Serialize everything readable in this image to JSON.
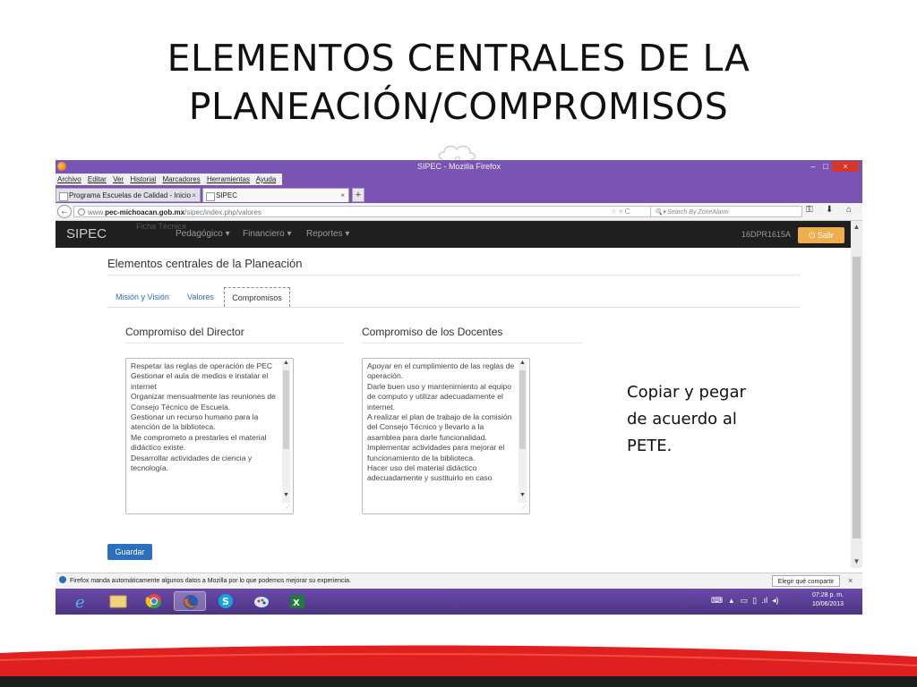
{
  "slide": {
    "title_line1": "ELEMENTOS CENTRALES DE LA",
    "title_line2": "PLANEACIÓN/COMPROMISOS",
    "side_note": "Copiar y pegar\nde acuerdo al\nPETE."
  },
  "window": {
    "title": "SIPEC - Mozilla Firefox",
    "minimize": "–",
    "maximize": "□",
    "close": "×"
  },
  "menu": [
    "Archivo",
    "Editar",
    "Ver",
    "Historial",
    "Marcadores",
    "Herramientas",
    "Ayuda"
  ],
  "tabs": [
    {
      "label": "Programa Escuelas de Calidad - Inicio",
      "close": "×"
    },
    {
      "label": "SIPEC",
      "close": "×"
    }
  ],
  "new_tab": "+",
  "nav": {
    "url_domain_prefix": "www.",
    "url_domain": "pec-michoacan.gob.mx",
    "url_path": "/sipec/index.php/valores",
    "search_placeholder": "Search By ZoneAlarm"
  },
  "app": {
    "brand": "SIPEC",
    "faded_label": "Ficha Técnica",
    "menus": [
      "Pedagógico ▾",
      "Financiero ▾",
      "Reportes ▾"
    ],
    "school_code": "16DPR1615A",
    "logout_label": "Salir"
  },
  "page": {
    "heading": "Elementos centrales de la Planeación",
    "tabs": [
      "Misión y Visión",
      "Valores",
      "Compromisos"
    ],
    "active_tab": "Compromisos",
    "director": {
      "heading": "Compromiso del Director",
      "text": "Respetar las  reglas de operación de PEC\nGestionar  el aula de medios  e instalar el internet\nOrganizar mensualmente  las reuniones de Consejo Técnico  de Escuela.\nGestionar un recurso humano para la atención de la biblioteca.\nMe comprometo a prestarles el material didáctico  existe.\nDesarrollar actividades de ciencia y tecnología."
    },
    "docentes": {
      "heading": "Compromiso de los Docentes",
      "text": "Apoyar en el cumplimiento  de las reglas de operación.\nDarle buen uso y mantenimiento al equipo de computo y utilizar adecuadamente el  internet.\nA realizar el plan de trabajo de la comisión del Consejo Técnico y llevarlo a la asamblea para darle funcionalidad.\nImplementar  actividades para mejorar el funcionamiento de la biblioteca.\nHacer uso del material didáctico adecuadamente y sustituirlo en caso"
    },
    "save_button": "Guardar"
  },
  "notification": {
    "text": "Firefox manda automáticamente algunos datos a Mozilla por lo que podemos mejorar su experiencia.",
    "button": "Elegir qué compartir",
    "close": "×"
  },
  "taskbar": {
    "time": "07:28 p. m.",
    "date": "10/06/2013",
    "apps": [
      "internet-explorer-icon",
      "file-explorer-icon",
      "chrome-icon",
      "firefox-icon",
      "skype-icon",
      "paint-icon",
      "excel-icon"
    ]
  },
  "colors": {
    "firefox_purple": "#7a54b3",
    "app_nav_dark": "#1f1f1f",
    "logout_orange": "#f0ad4e",
    "save_blue": "#2b6fbd",
    "slide_red": "#e02020"
  }
}
